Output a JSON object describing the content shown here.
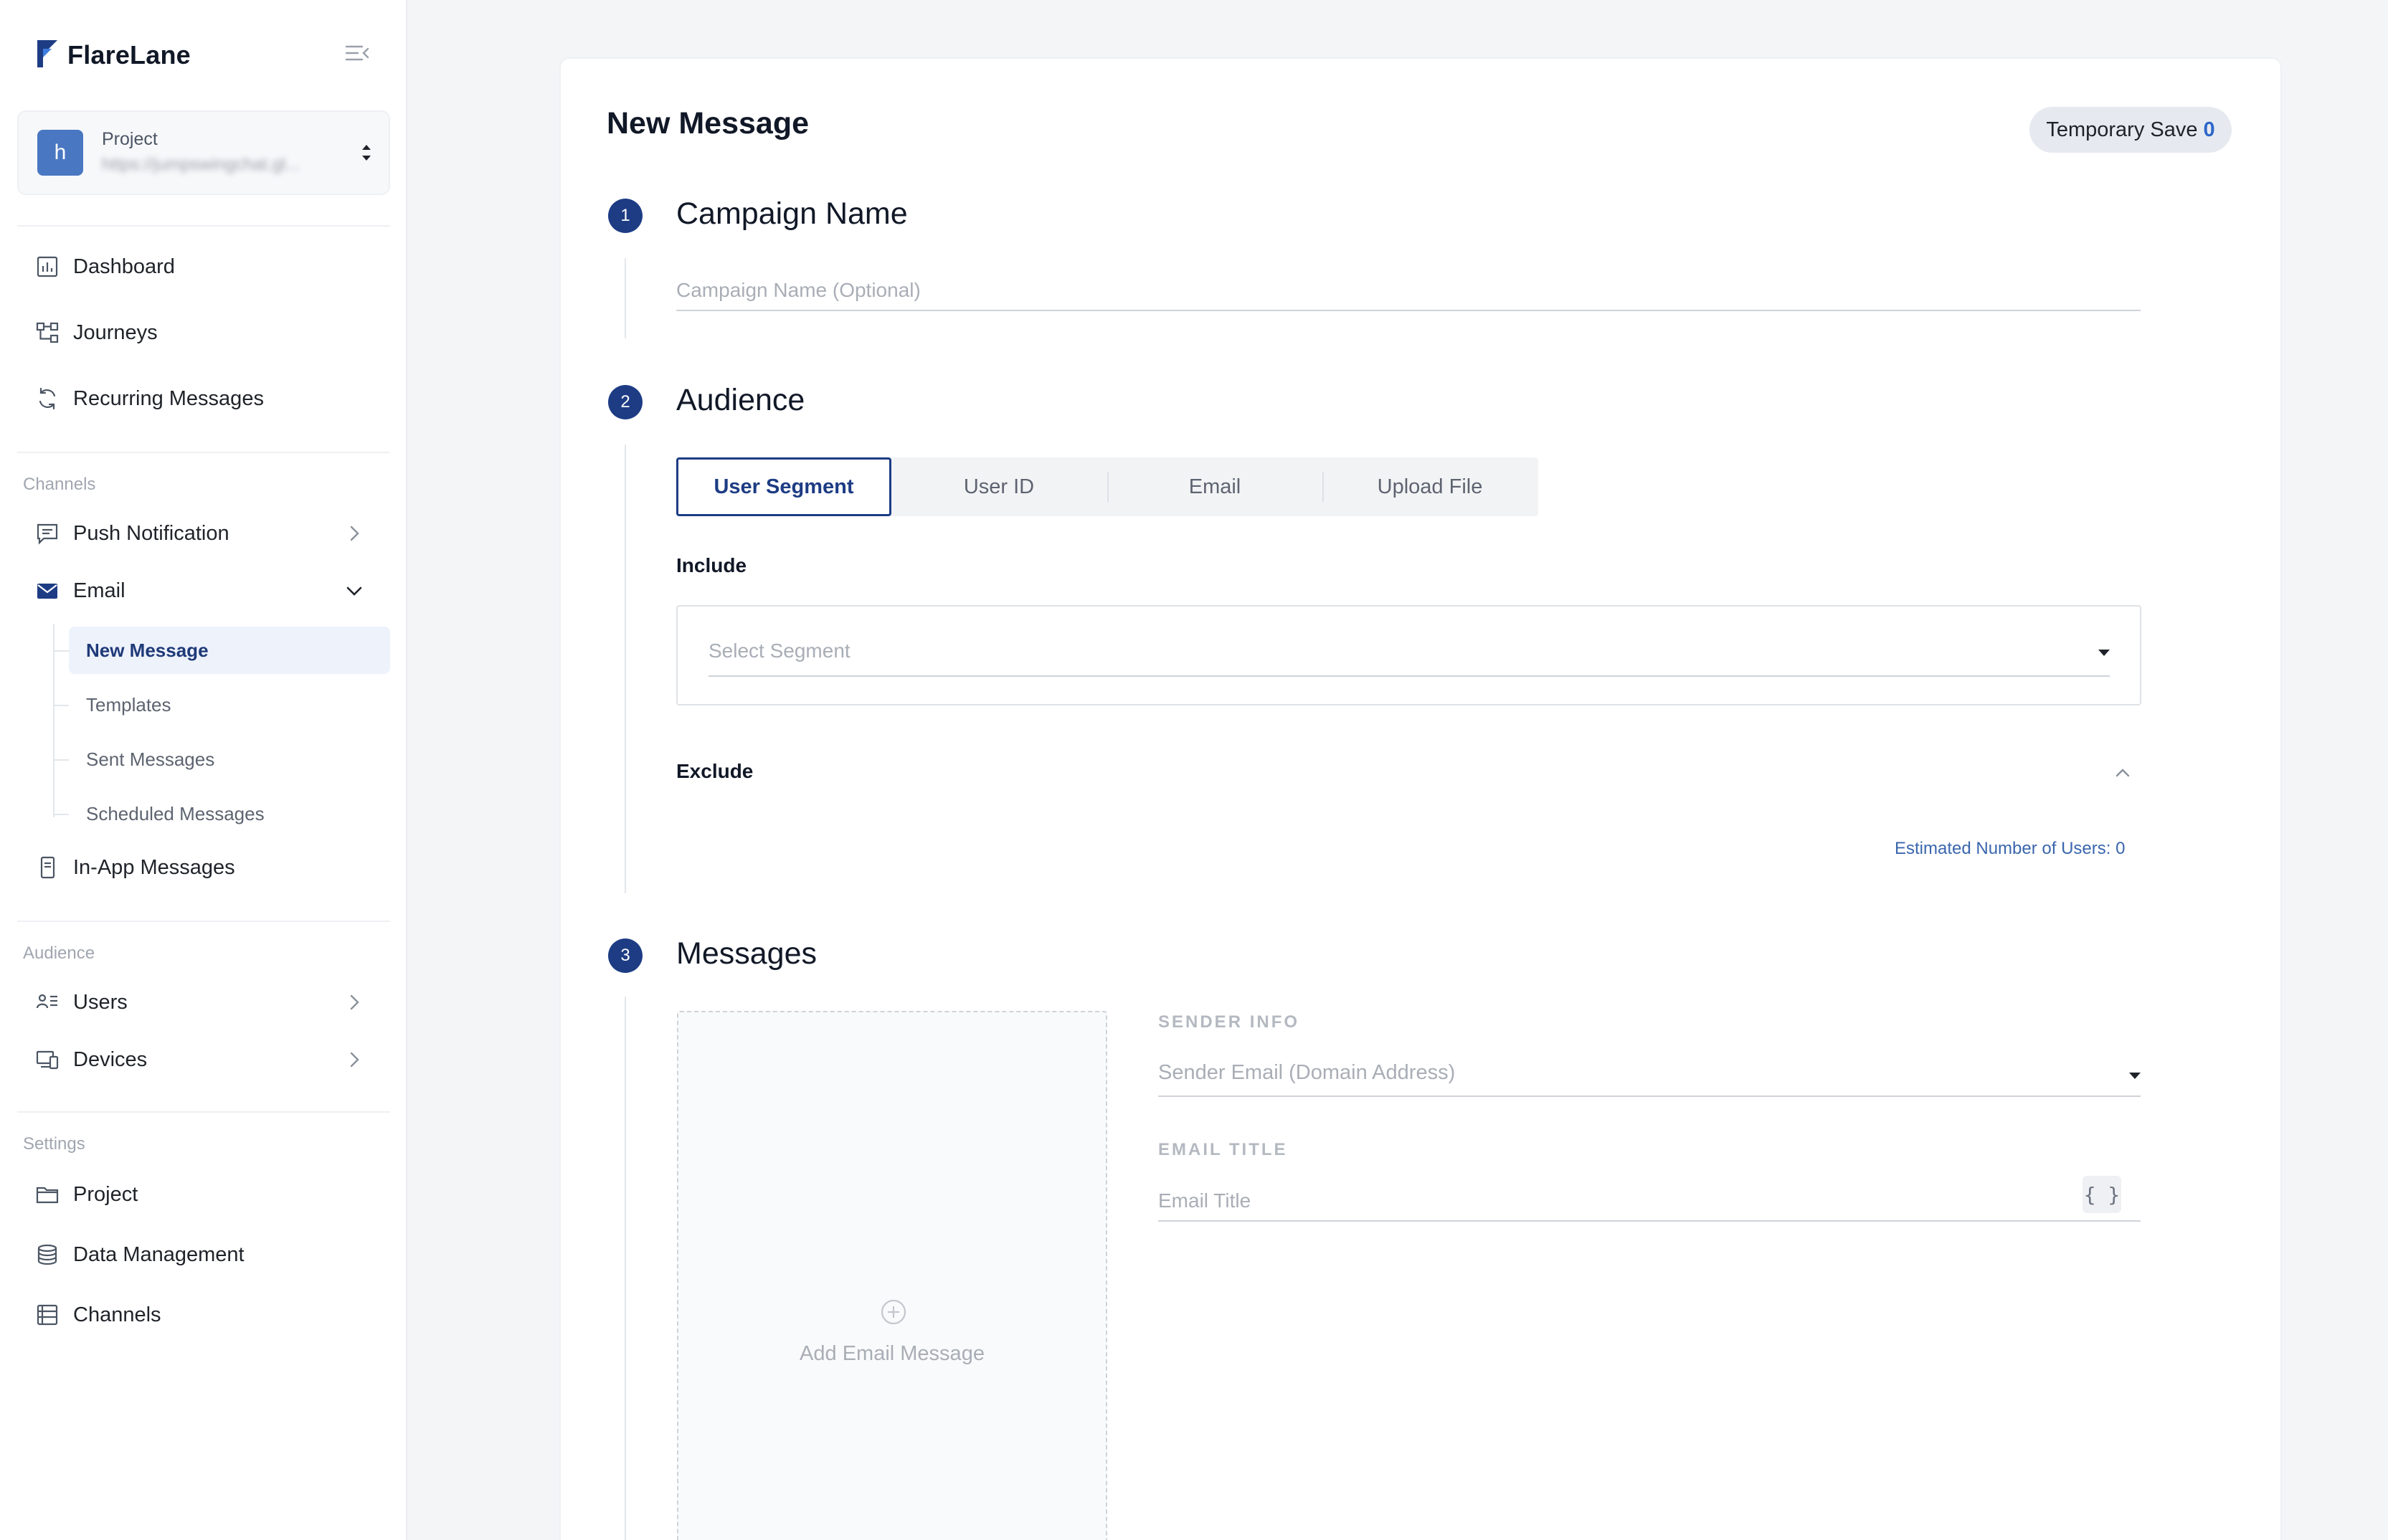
{
  "brand": {
    "name": "FlareLane",
    "accent": "#1d3c84"
  },
  "project": {
    "label": "Project",
    "avatar_letter": "h",
    "url": "https://jumpswingchat.gl..."
  },
  "nav": {
    "main": [
      {
        "label": "Dashboard",
        "icon": "chart-icon"
      },
      {
        "label": "Journeys",
        "icon": "flow-icon"
      },
      {
        "label": "Recurring Messages",
        "icon": "refresh-icon"
      }
    ],
    "channels_label": "Channels",
    "push_notification": "Push Notification",
    "email": "Email",
    "email_sub": [
      "New Message",
      "Templates",
      "Sent Messages",
      "Scheduled Messages"
    ],
    "in_app": "In-App Messages",
    "audience_label": "Audience",
    "users": "Users",
    "devices": "Devices",
    "settings_label": "Settings",
    "project": "Project",
    "data_management": "Data Management",
    "channels": "Channels"
  },
  "page": {
    "title": "New Message",
    "temp_save_label": "Temporary Save",
    "temp_save_count": "0"
  },
  "steps": {
    "campaign": {
      "number": "1",
      "title": "Campaign Name",
      "placeholder": "Campaign Name (Optional)"
    },
    "audience": {
      "number": "2",
      "title": "Audience",
      "tabs": [
        "User Segment",
        "User ID",
        "Email",
        "Upload File"
      ],
      "active_tab": "User Segment",
      "include_label": "Include",
      "segment_placeholder": "Select Segment",
      "exclude_label": "Exclude",
      "estimate": "Estimated Number of Users: 0"
    },
    "messages": {
      "number": "3",
      "title": "Messages",
      "add_label": "Add Email Message",
      "sender_info_label": "SENDER INFO",
      "sender_placeholder": "Sender Email (Domain Address)",
      "email_title_label": "EMAIL TITLE",
      "email_title_placeholder": "Email Title",
      "variable_button": "{ }"
    }
  }
}
